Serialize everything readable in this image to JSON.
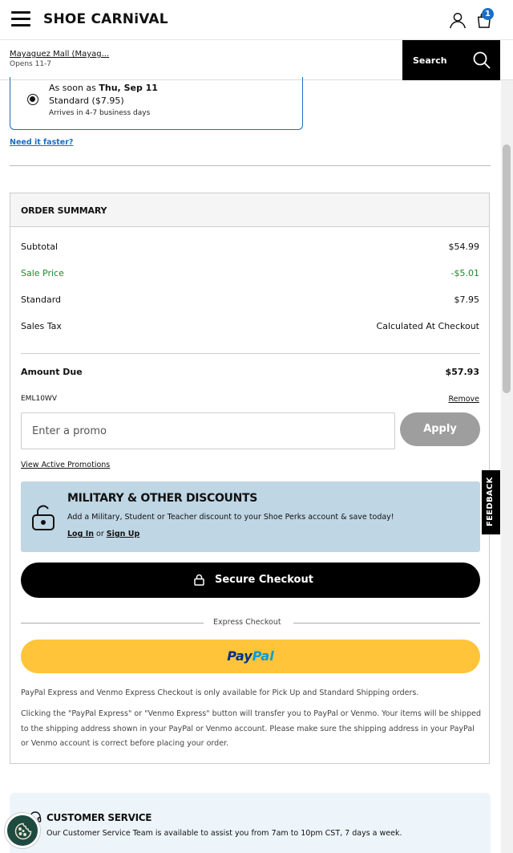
{
  "header": {
    "logo": "SHOE CARNiVAL",
    "cart_count": "1"
  },
  "store": {
    "name": "Mayaguez Mall (Mayag...",
    "hours": "Opens 11-7"
  },
  "search": {
    "label": "Search"
  },
  "shipping": {
    "soon_prefix": "As soon as ",
    "soon_date": "Thu, Sep 11",
    "standard": "Standard  ($7.95)",
    "arrives": "Arrives in 4-7 business days",
    "need_faster": "Need it faster?"
  },
  "summary": {
    "title": "ORDER SUMMARY",
    "rows": [
      {
        "label": "Subtotal",
        "value": "$54.99"
      },
      {
        "label": "Sale Price",
        "value": "-$5.01"
      },
      {
        "label": "Standard",
        "value": "$7.95"
      },
      {
        "label": "Sales Tax",
        "value": "Calculated At Checkout"
      }
    ],
    "amount_due_label": "Amount Due",
    "amount_due_value": "$57.93",
    "applied_code": "EML10WV",
    "remove": "Remove",
    "promo_placeholder": "Enter a promo",
    "apply": "Apply",
    "view_promos": "View Active Promotions"
  },
  "military": {
    "title": "MILITARY & OTHER DISCOUNTS",
    "text": "Add a Military, Student or Teacher discount to your Shoe Perks account & save today!",
    "login": "Log In",
    "or": " or ",
    "signup": "Sign Up"
  },
  "checkout": {
    "label": "Secure Checkout",
    "express_label": "Express Checkout",
    "paypal_a": "Pay",
    "paypal_b": "Pal",
    "note1": "PayPal Express and Venmo Express Checkout is only available for Pick Up and Standard Shipping orders.",
    "note2": "Clicking the \"PayPal Express\" or \"Venmo Express\" button will transfer you to PayPal or Venmo. Your items will be shipped to the shipping address shown in your PayPal or Venmo account. Please make sure the shipping address in your PayPal or Venmo account is correct before placing your order."
  },
  "customer_service": {
    "title": "CUSTOMER SERVICE",
    "text": "Our Customer Service Team is available to assist you from 7am to 10pm CST, 7 days a week."
  },
  "feedback": "FEEDBACK",
  "colors": {
    "accent_blue": "#1a6fc4",
    "sale_green": "#1f8a2a",
    "paypal_yellow": "#ffc439",
    "military_bg": "#bfd6e4"
  }
}
